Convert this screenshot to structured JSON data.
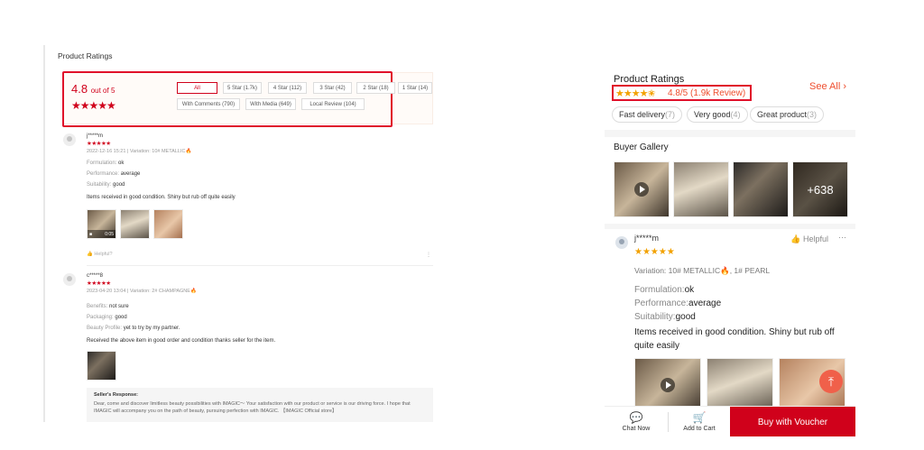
{
  "desktop": {
    "title": "Product Ratings",
    "overview": {
      "score": "4.8",
      "score_suffix": "out of 5",
      "stars": "★★★★★",
      "filters": [
        "All",
        "5 Star (1.7k)",
        "4 Star (112)",
        "3 Star (42)",
        "2 Star (18)",
        "1 Star (14)"
      ],
      "filters2": [
        "With Comments (790)",
        "With Media (649)",
        "Local Review (104)"
      ]
    },
    "reviews": [
      {
        "user": "j*****m",
        "stars": "★★★★★",
        "meta": "2022-12-16 15:21 | Variation: 10# METALLIC🔥",
        "lines": [
          {
            "k": "Formulation:",
            "v": "ok"
          },
          {
            "k": "Performance:",
            "v": "average"
          },
          {
            "k": "Suitability:",
            "v": "good"
          }
        ],
        "body": "Items received in good condition. Shiny but rub off quite easily",
        "video_duration": "0:05",
        "helpful": "Helpful?"
      },
      {
        "user": "c*****8",
        "stars": "★★★★★",
        "meta": "2023-04-20 13:04 | Variation: 2# CHAMPAGNE🔥",
        "lines": [
          {
            "k": "Benefits:",
            "v": "not sure"
          },
          {
            "k": "Packaging:",
            "v": "good"
          },
          {
            "k": "Beauty Profile:",
            "v": "yet to try by my partner."
          }
        ],
        "body": "Received the above item in good order and condition thanks seller for the item.",
        "seller_title": "Seller's Response:",
        "seller_text": "Dear, come and discover limitless beauty possibilities with IMAGIC～ Your satisfaction with our product or service is our driving force. I hope that IMAGIC will accompany you on the path of beauty, pursuing perfection with IMAGIC. 【IMAGIC Official store】"
      }
    ]
  },
  "mobile": {
    "title": "Product Ratings",
    "see_all": "See All",
    "stars": "★★★★✬",
    "score": "4.8/5",
    "count": "(1.9k Review)",
    "tags": [
      {
        "label": "Fast delivery",
        "count": "(7)"
      },
      {
        "label": "Very good",
        "count": "(4)"
      },
      {
        "label": "Great product",
        "count": "(3)"
      }
    ],
    "gallery_title": "Buyer Gallery",
    "gallery_more": "+638",
    "review": {
      "user": "j*****m",
      "stars": "★★★★★",
      "helpful": "Helpful",
      "more": "···",
      "variation": "Variation: 10# METALLIC🔥, 1# PEARL",
      "lines": [
        {
          "k": "Formulation:",
          "v": "ok"
        },
        {
          "k": "Performance:",
          "v": "average"
        },
        {
          "k": "Suitability:",
          "v": "good"
        }
      ],
      "body": "Items received in good condition. Shiny but rub off quite easily"
    },
    "bottom": {
      "chat": "Chat Now",
      "cart": "Add to Cart",
      "buy": "Buy with Voucher"
    }
  }
}
